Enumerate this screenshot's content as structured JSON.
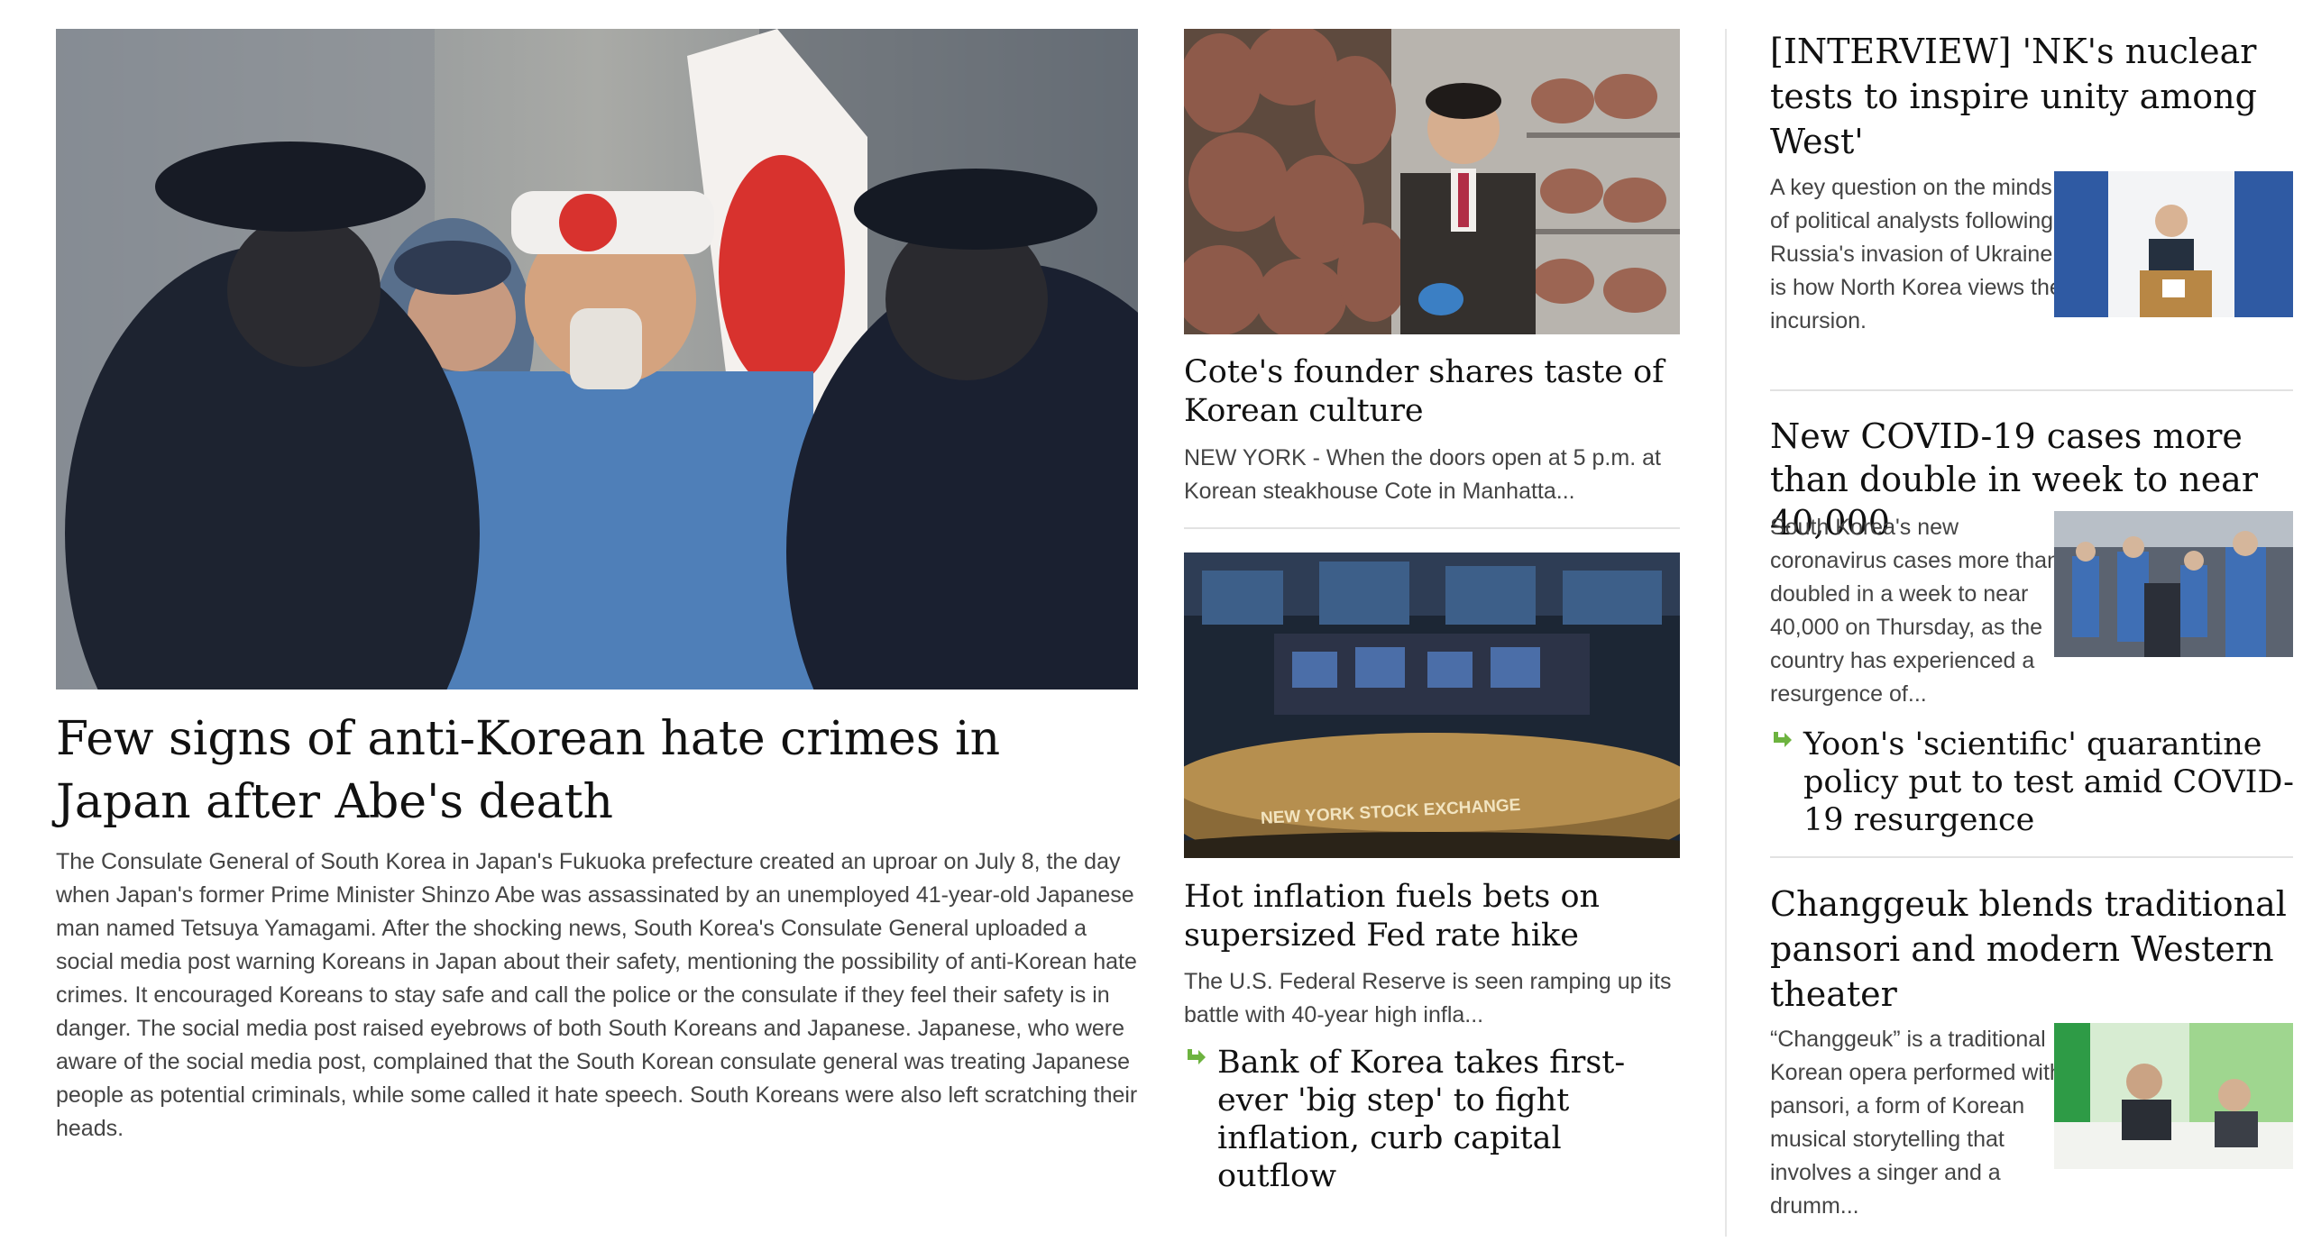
{
  "lead": {
    "headline": "Few signs of anti-Korean hate crimes in Japan after Abe's death",
    "summary": "The Consulate General of South Korea in Japan's Fukuoka prefecture created an uproar on July 8, the day when Japan's former Prime Minister Shinzo Abe was assassinated by an unemployed 41-year-old Japanese man named Tetsuya Yamagami. After the shocking news, South Korea's Consulate General uploaded a social media post warning Koreans in Japan about their safety, mentioning the possibility of anti-Korean hate crimes. It encouraged Koreans to stay safe and call the police or the consulate if they feel their safety is in danger. The social media post raised eyebrows of both South Koreans and Japanese. Japanese, who were aware of the social media post, complained that the South Korean consulate general was treating Japanese people as potential criminals, while some called it hate speech. South Koreans were also left scratching their heads."
  },
  "middle": {
    "story1": {
      "headline": "Cote's founder shares taste of Korean culture",
      "summary": "NEW YORK - When the doors open at 5 p.m. at Korean steakhouse Cote in Manhatta..."
    },
    "story2": {
      "headline": "Hot inflation fuels bets on supersized Fed rate hike",
      "summary": "The U.S. Federal Reserve is seen ramping up its battle with 40-year high infla...",
      "photo_sign": "NEW YORK STOCK EXCHANGE",
      "related": "Bank of Korea takes first-ever 'big step' to fight inflation, curb capital outflow"
    }
  },
  "right": {
    "story1": {
      "headline": "[INTERVIEW] 'NK's nuclear tests to inspire unity among West'",
      "summary": "A key question on the minds of political analysts following Russia's invasion of Ukraine is how North Korea views the incursion."
    },
    "story2": {
      "headline": "New COVID-19 cases more than double in week to near 40,000",
      "summary": "South Korea's new coronavirus cases more than doubled in a week to near 40,000 on Thursday, as the country has experienced a resurgence of...",
      "related": "Yoon's 'scientific' quarantine policy put to test amid COVID-19 resurgence"
    },
    "story3": {
      "headline": "Changgeuk blends traditional pansori and modern Western theater",
      "summary": "“Changgeuk” is a traditional Korean opera performed with pansori, a form of Korean musical storytelling that involves a singer and a drumm..."
    }
  },
  "icons": {
    "related_arrow": "arrow-right-icon"
  },
  "colors": {
    "accent_arrow": "#6db33f",
    "divider": "#e2e2e2"
  }
}
